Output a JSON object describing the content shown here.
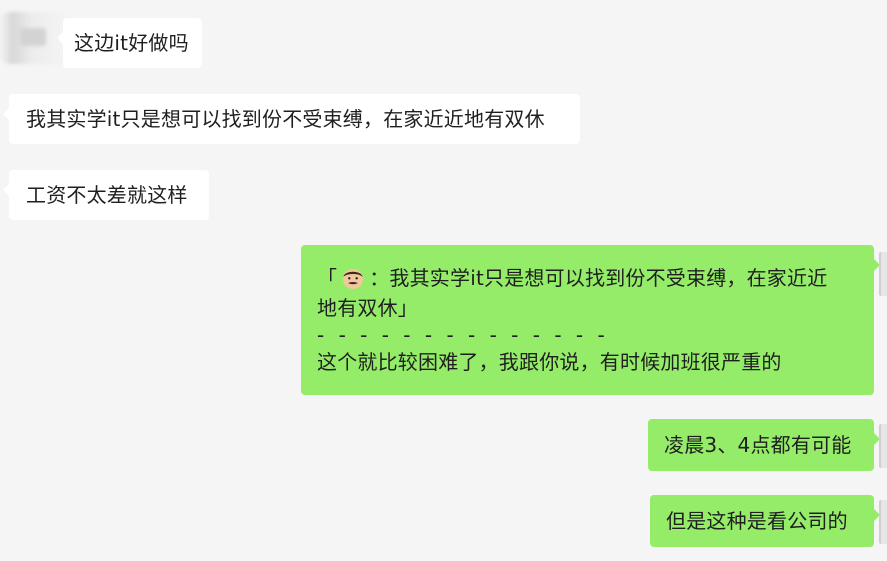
{
  "messages": [
    {
      "side": "left",
      "text": "这边it好做吗"
    },
    {
      "side": "left",
      "text": "我其实学it只是想可以找到份不受束缚，在家近近地有双休"
    },
    {
      "side": "left",
      "text": "工资不太差就这样"
    },
    {
      "side": "right",
      "quote_open": "「",
      "quote_after_emoji": "：我其实学it只是想可以找到份不受束缚，在家近近",
      "quote_line2": "地有双休」",
      "separator": "- - - - - - - - - - - - - -",
      "reply": "这个就比较困难了，我跟你说，有时候加班很严重的"
    },
    {
      "side": "right",
      "text": "凌晨3、4点都有可能"
    },
    {
      "side": "right",
      "text": "但是这种是看公司的"
    }
  ],
  "icons": {
    "quoted_avatar": "man-face-emoji-icon"
  },
  "colors": {
    "background": "#f5f5f5",
    "incoming_bubble": "#ffffff",
    "outgoing_bubble": "#95ec69",
    "text": "#1f1f1f"
  }
}
